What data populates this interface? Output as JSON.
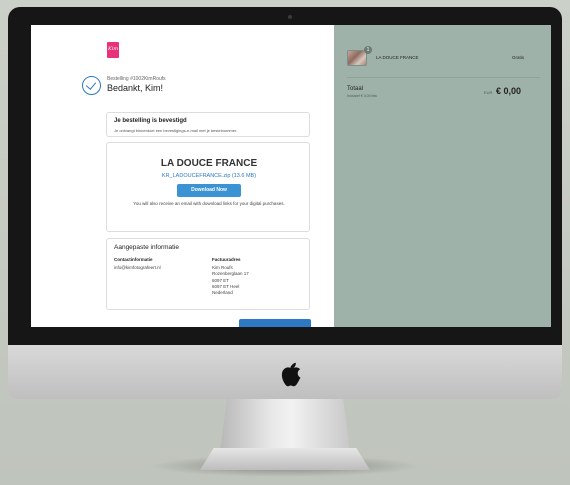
{
  "brand": {
    "logo_text": "Kim"
  },
  "order": {
    "number": "Bestelling #1002KimRoufs",
    "thanks": "Bedankt, Kim!"
  },
  "confirmation": {
    "heading": "Je bestelling is bevestigd",
    "text": "Je ontvangt binnenkort een bevestigings-e-mail met je bestelnummer."
  },
  "download": {
    "product": "LA DOUCE FRANCE",
    "file": "KR_LADOUCEFRANCE.zip (13.6 MB)",
    "button": "Download Now",
    "note": "You will also receive an email with download links for your digital purchases."
  },
  "info": {
    "heading": "Aangepaste informatie",
    "contact_label": "Contactinformatie",
    "contact_email": "info@kimfotografeert.nl",
    "billing_label": "Factuuradres",
    "billing_lines": [
      "Kim Roufs",
      "Rozenberglaan 17",
      "6097 ET",
      "6097 ET Heel",
      "Nederland"
    ]
  },
  "summary": {
    "item_name": "LA DOUCE FRANCE",
    "item_qty": "1",
    "item_price": "Gratis",
    "total_label": "Totaal",
    "tax_note": "Inclusief € 0,00 btw",
    "currency": "EUR",
    "total": "€ 0,00"
  },
  "colors": {
    "accent": "#2d79c4",
    "summary_bg": "#9fb2aa",
    "logo": "#e8337a"
  }
}
